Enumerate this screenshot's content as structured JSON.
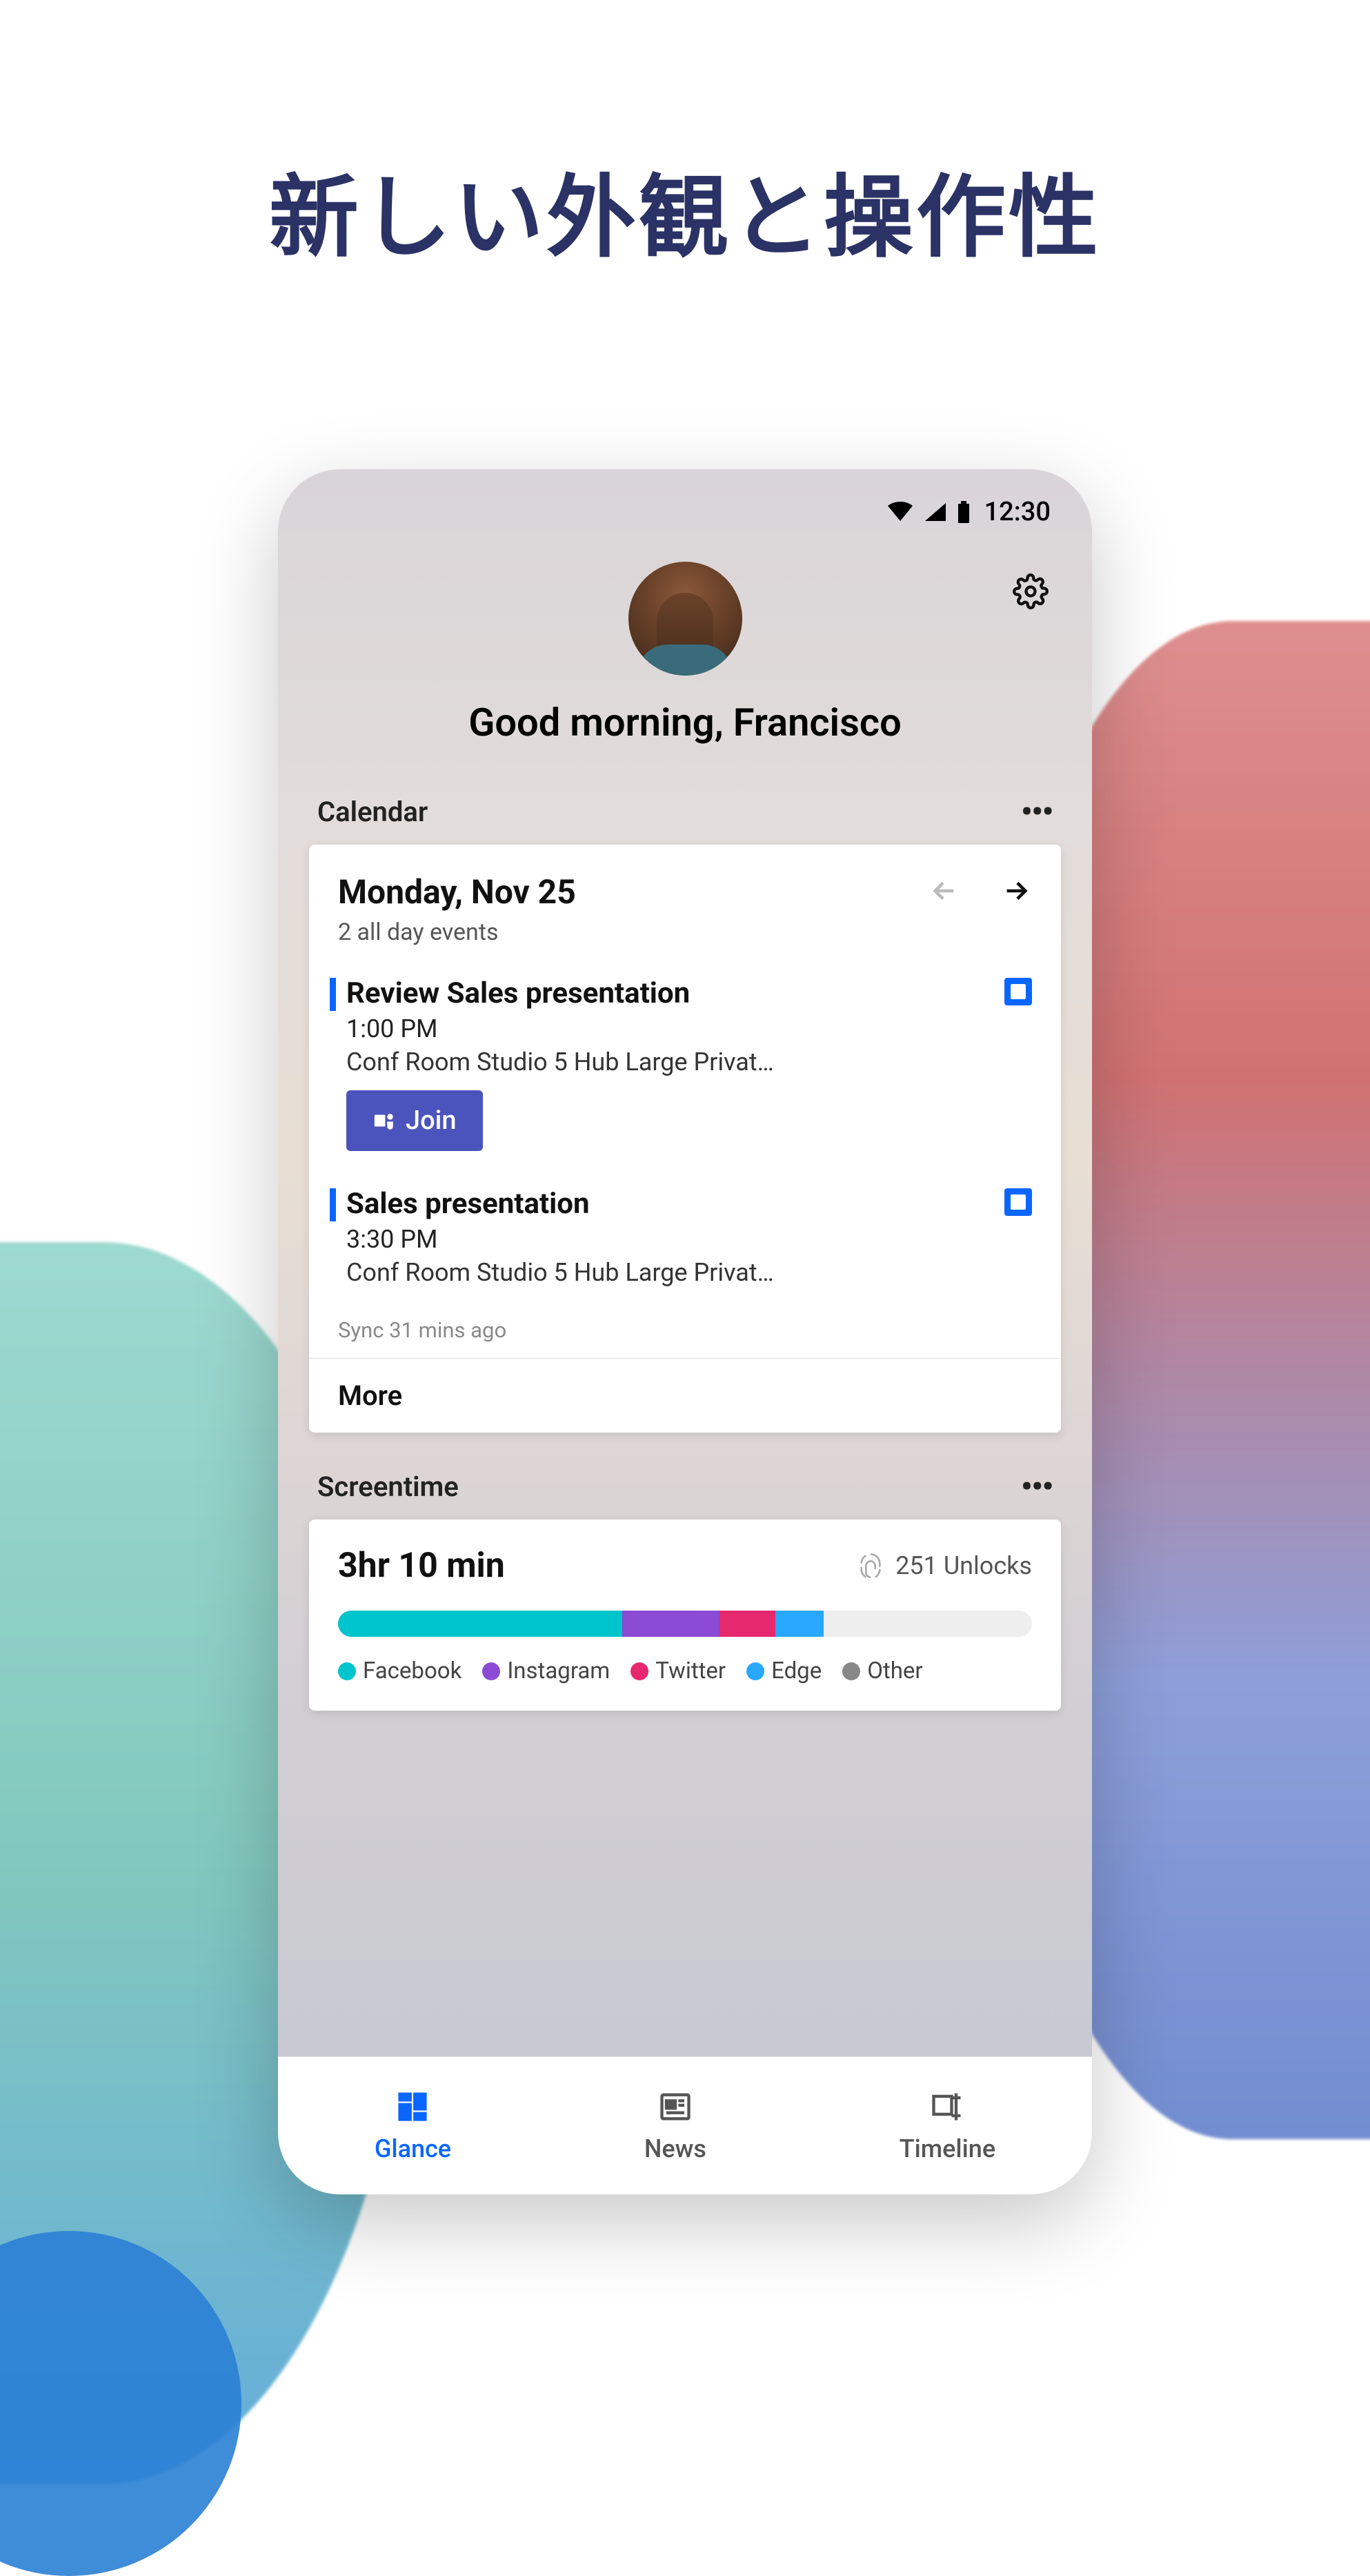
{
  "headline": "新しい外観と操作性",
  "status": {
    "time": "12:30"
  },
  "greeting": "Good morning, Francisco",
  "calendar": {
    "section_title": "Calendar",
    "date": "Monday, Nov 25",
    "all_day": "2 all day events",
    "events": [
      {
        "title": "Review Sales presentation",
        "time": "1:00 PM",
        "location": "Conf Room Studio 5 Hub Large Privat…",
        "join_label": "Join"
      },
      {
        "title": "Sales presentation",
        "time": "3:30 PM",
        "location": "Conf Room Studio 5 Hub Large Privat…"
      }
    ],
    "sync": "Sync 31 mins ago",
    "more_label": "More"
  },
  "screentime": {
    "section_title": "Screentime",
    "total": "3hr 10 min",
    "unlocks": "251 Unlocks",
    "legend": {
      "facebook": "Facebook",
      "instagram": "Instagram",
      "twitter": "Twitter",
      "edge": "Edge",
      "other": "Other"
    }
  },
  "nav": {
    "glance": "Glance",
    "news": "News",
    "timeline": "Timeline"
  }
}
